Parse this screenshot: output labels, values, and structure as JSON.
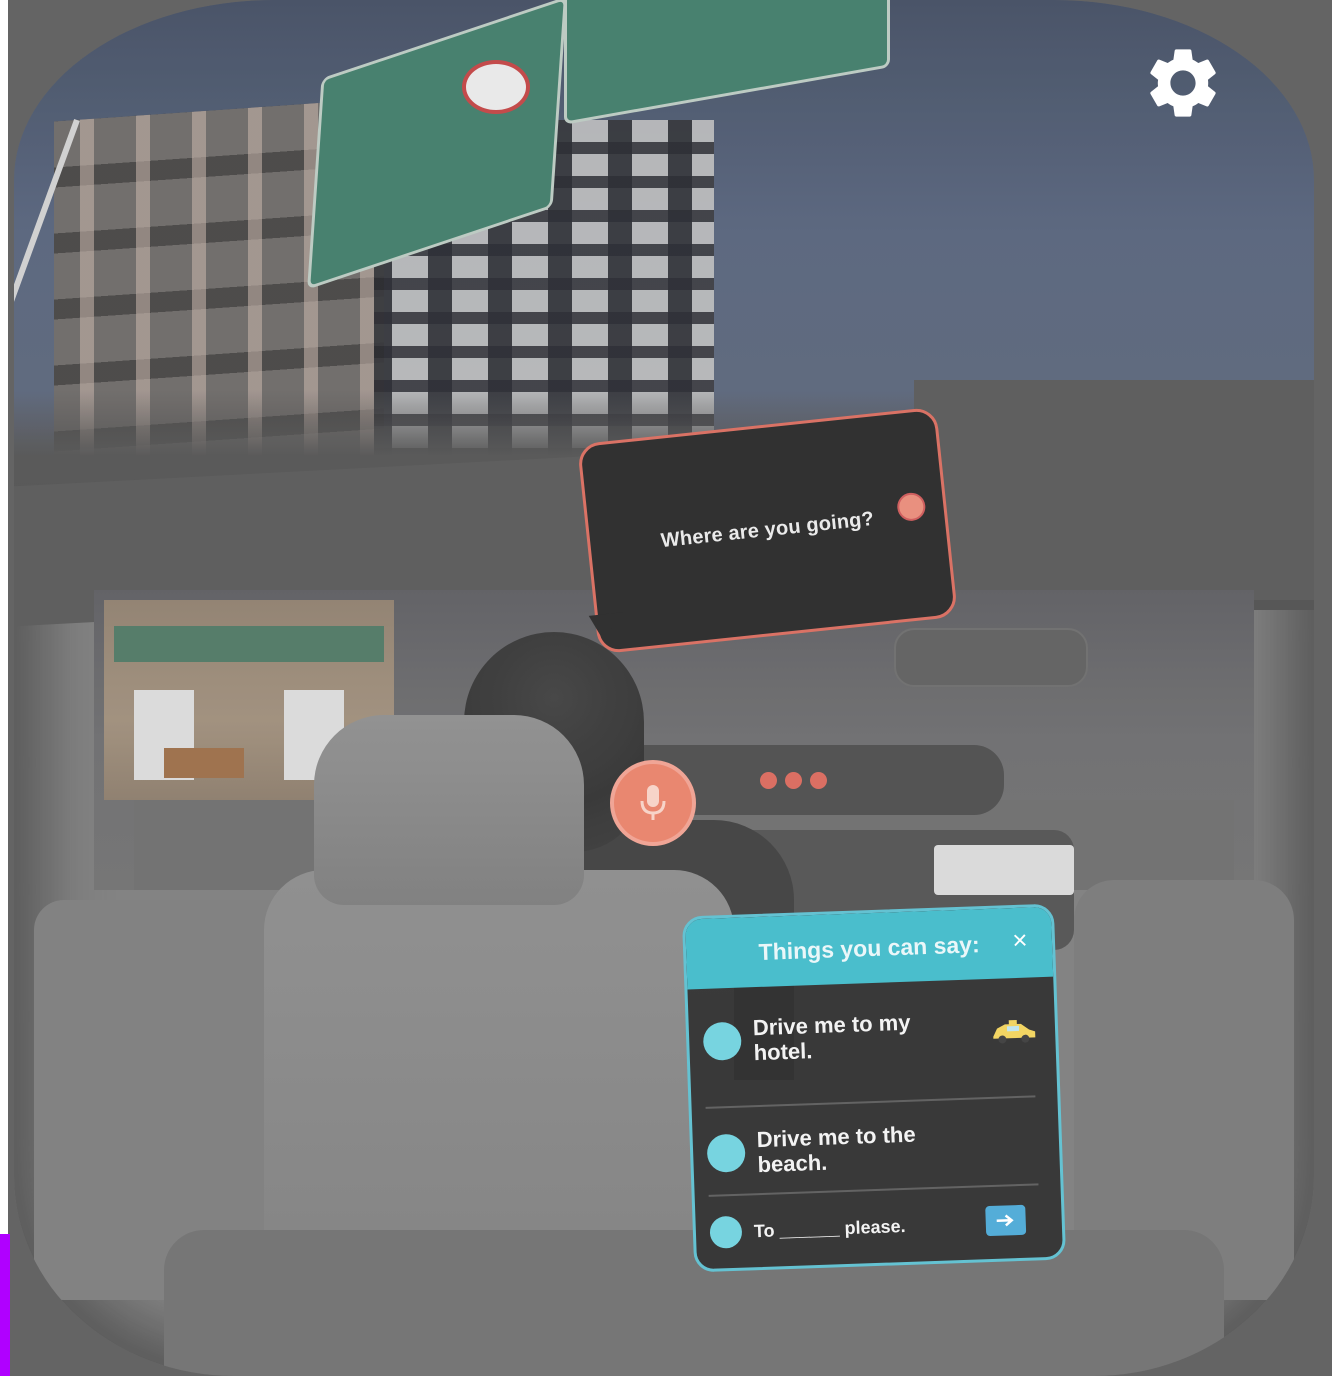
{
  "speech_bubble": {
    "text": "Where are you going?"
  },
  "suggestions_panel": {
    "title": "Things you can say:",
    "close_label": "×",
    "phrases": [
      {
        "text": "Drive me to my hotel."
      },
      {
        "text": "Drive me to the beach."
      },
      {
        "text": "To ______ please."
      }
    ]
  },
  "icons": {
    "settings": "gear-icon",
    "microphone": "microphone-icon",
    "taxi": "taxi-icon",
    "send": "send-icon",
    "close": "close-icon"
  },
  "colors": {
    "accent_cyan": "#3fbac9",
    "accent_coral": "#e88068",
    "bubble_border": "#d86a5c"
  }
}
